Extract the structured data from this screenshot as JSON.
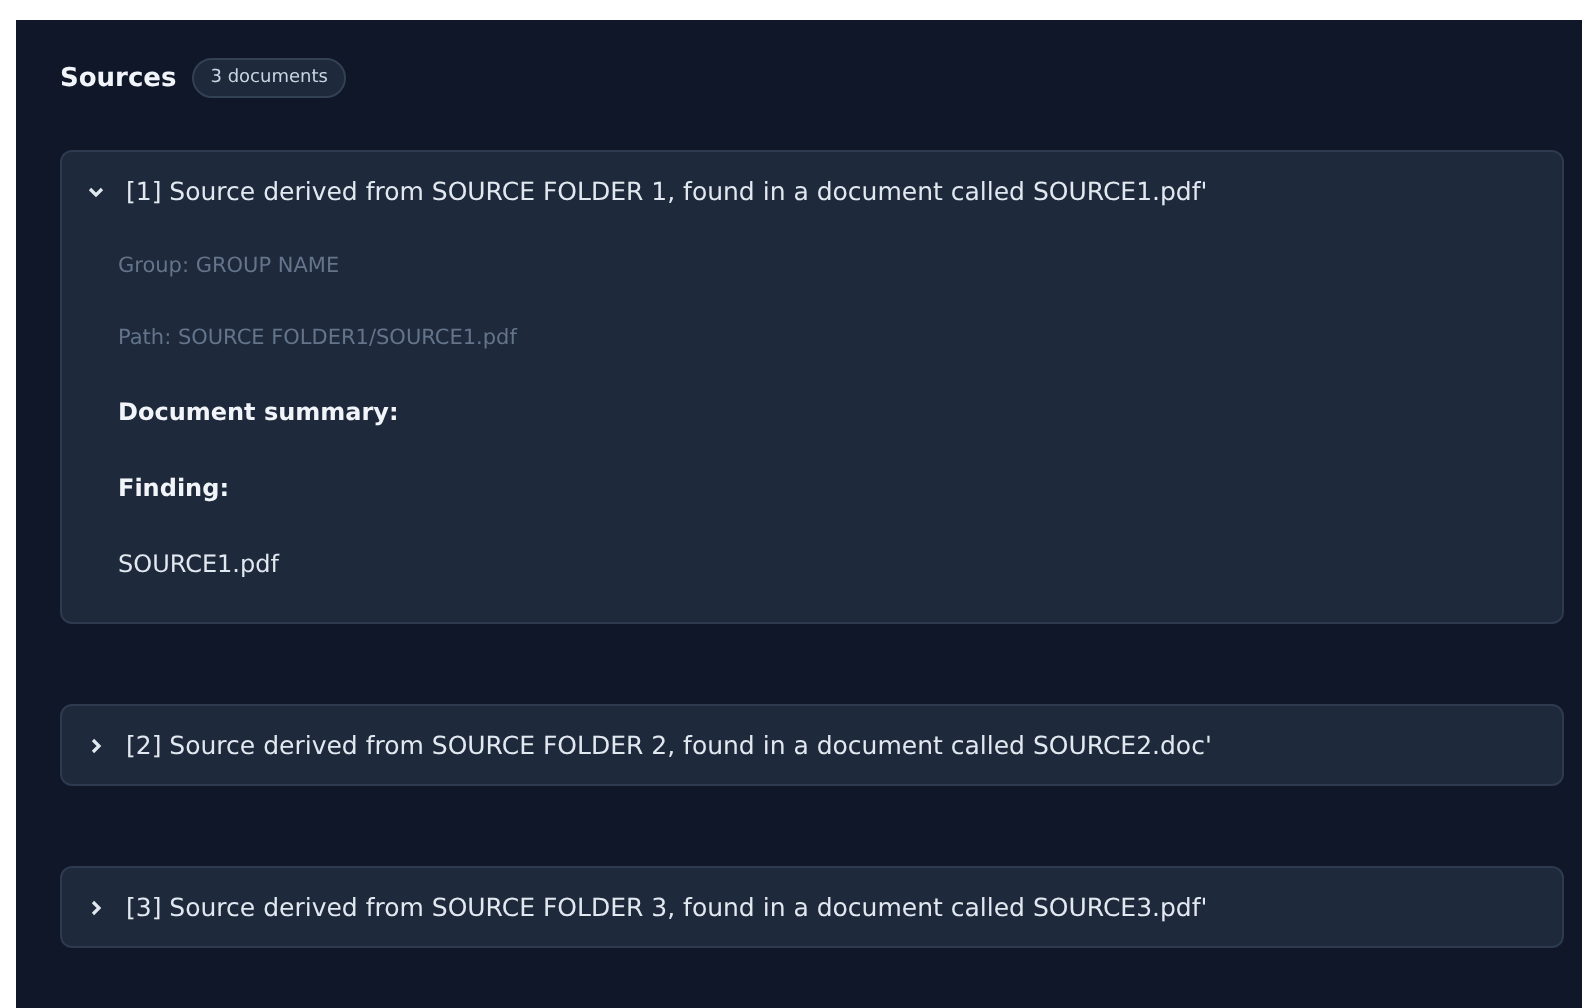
{
  "header": {
    "title": "Sources",
    "badge": "3 documents"
  },
  "sources": [
    {
      "title": "[1] Source derived from SOURCE FOLDER 1, found in a document called SOURCE1.pdf'",
      "expanded": true,
      "meta": [
        "Group: GROUP NAME",
        "Path: SOURCE FOLDER1/SOURCE1.pdf"
      ],
      "headings": [
        "Document summary:",
        "Finding:"
      ],
      "body": "SOURCE1.pdf"
    },
    {
      "title": "[2] Source derived from SOURCE FOLDER 2, found in a document called SOURCE2.doc'",
      "expanded": false
    },
    {
      "title": "[3] Source derived from SOURCE FOLDER 3, found in a document called SOURCE3.pdf'",
      "expanded": false
    }
  ]
}
